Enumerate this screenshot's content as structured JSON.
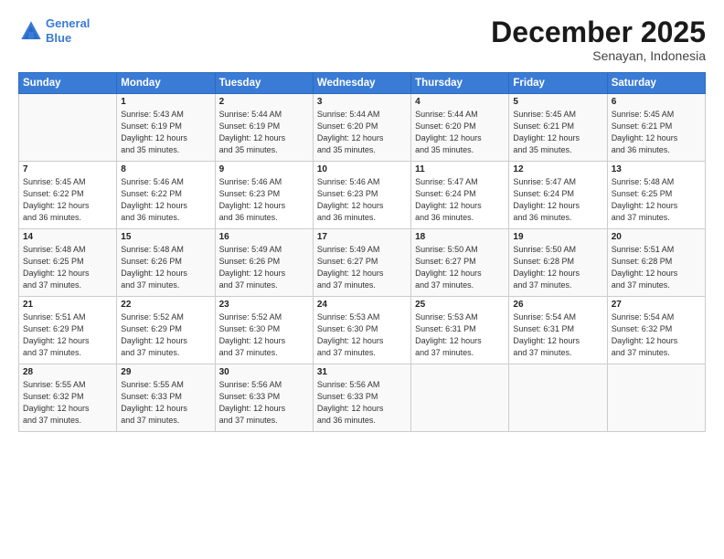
{
  "logo": {
    "line1": "General",
    "line2": "Blue"
  },
  "title": "December 2025",
  "location": "Senayan, Indonesia",
  "days_header": [
    "Sunday",
    "Monday",
    "Tuesday",
    "Wednesday",
    "Thursday",
    "Friday",
    "Saturday"
  ],
  "weeks": [
    [
      {
        "num": "",
        "info": ""
      },
      {
        "num": "1",
        "info": "Sunrise: 5:43 AM\nSunset: 6:19 PM\nDaylight: 12 hours\nand 35 minutes."
      },
      {
        "num": "2",
        "info": "Sunrise: 5:44 AM\nSunset: 6:19 PM\nDaylight: 12 hours\nand 35 minutes."
      },
      {
        "num": "3",
        "info": "Sunrise: 5:44 AM\nSunset: 6:20 PM\nDaylight: 12 hours\nand 35 minutes."
      },
      {
        "num": "4",
        "info": "Sunrise: 5:44 AM\nSunset: 6:20 PM\nDaylight: 12 hours\nand 35 minutes."
      },
      {
        "num": "5",
        "info": "Sunrise: 5:45 AM\nSunset: 6:21 PM\nDaylight: 12 hours\nand 35 minutes."
      },
      {
        "num": "6",
        "info": "Sunrise: 5:45 AM\nSunset: 6:21 PM\nDaylight: 12 hours\nand 36 minutes."
      }
    ],
    [
      {
        "num": "7",
        "info": "Sunrise: 5:45 AM\nSunset: 6:22 PM\nDaylight: 12 hours\nand 36 minutes."
      },
      {
        "num": "8",
        "info": "Sunrise: 5:46 AM\nSunset: 6:22 PM\nDaylight: 12 hours\nand 36 minutes."
      },
      {
        "num": "9",
        "info": "Sunrise: 5:46 AM\nSunset: 6:23 PM\nDaylight: 12 hours\nand 36 minutes."
      },
      {
        "num": "10",
        "info": "Sunrise: 5:46 AM\nSunset: 6:23 PM\nDaylight: 12 hours\nand 36 minutes."
      },
      {
        "num": "11",
        "info": "Sunrise: 5:47 AM\nSunset: 6:24 PM\nDaylight: 12 hours\nand 36 minutes."
      },
      {
        "num": "12",
        "info": "Sunrise: 5:47 AM\nSunset: 6:24 PM\nDaylight: 12 hours\nand 36 minutes."
      },
      {
        "num": "13",
        "info": "Sunrise: 5:48 AM\nSunset: 6:25 PM\nDaylight: 12 hours\nand 37 minutes."
      }
    ],
    [
      {
        "num": "14",
        "info": "Sunrise: 5:48 AM\nSunset: 6:25 PM\nDaylight: 12 hours\nand 37 minutes."
      },
      {
        "num": "15",
        "info": "Sunrise: 5:48 AM\nSunset: 6:26 PM\nDaylight: 12 hours\nand 37 minutes."
      },
      {
        "num": "16",
        "info": "Sunrise: 5:49 AM\nSunset: 6:26 PM\nDaylight: 12 hours\nand 37 minutes."
      },
      {
        "num": "17",
        "info": "Sunrise: 5:49 AM\nSunset: 6:27 PM\nDaylight: 12 hours\nand 37 minutes."
      },
      {
        "num": "18",
        "info": "Sunrise: 5:50 AM\nSunset: 6:27 PM\nDaylight: 12 hours\nand 37 minutes."
      },
      {
        "num": "19",
        "info": "Sunrise: 5:50 AM\nSunset: 6:28 PM\nDaylight: 12 hours\nand 37 minutes."
      },
      {
        "num": "20",
        "info": "Sunrise: 5:51 AM\nSunset: 6:28 PM\nDaylight: 12 hours\nand 37 minutes."
      }
    ],
    [
      {
        "num": "21",
        "info": "Sunrise: 5:51 AM\nSunset: 6:29 PM\nDaylight: 12 hours\nand 37 minutes."
      },
      {
        "num": "22",
        "info": "Sunrise: 5:52 AM\nSunset: 6:29 PM\nDaylight: 12 hours\nand 37 minutes."
      },
      {
        "num": "23",
        "info": "Sunrise: 5:52 AM\nSunset: 6:30 PM\nDaylight: 12 hours\nand 37 minutes."
      },
      {
        "num": "24",
        "info": "Sunrise: 5:53 AM\nSunset: 6:30 PM\nDaylight: 12 hours\nand 37 minutes."
      },
      {
        "num": "25",
        "info": "Sunrise: 5:53 AM\nSunset: 6:31 PM\nDaylight: 12 hours\nand 37 minutes."
      },
      {
        "num": "26",
        "info": "Sunrise: 5:54 AM\nSunset: 6:31 PM\nDaylight: 12 hours\nand 37 minutes."
      },
      {
        "num": "27",
        "info": "Sunrise: 5:54 AM\nSunset: 6:32 PM\nDaylight: 12 hours\nand 37 minutes."
      }
    ],
    [
      {
        "num": "28",
        "info": "Sunrise: 5:55 AM\nSunset: 6:32 PM\nDaylight: 12 hours\nand 37 minutes."
      },
      {
        "num": "29",
        "info": "Sunrise: 5:55 AM\nSunset: 6:33 PM\nDaylight: 12 hours\nand 37 minutes."
      },
      {
        "num": "30",
        "info": "Sunrise: 5:56 AM\nSunset: 6:33 PM\nDaylight: 12 hours\nand 37 minutes."
      },
      {
        "num": "31",
        "info": "Sunrise: 5:56 AM\nSunset: 6:33 PM\nDaylight: 12 hours\nand 36 minutes."
      },
      {
        "num": "",
        "info": ""
      },
      {
        "num": "",
        "info": ""
      },
      {
        "num": "",
        "info": ""
      }
    ]
  ]
}
